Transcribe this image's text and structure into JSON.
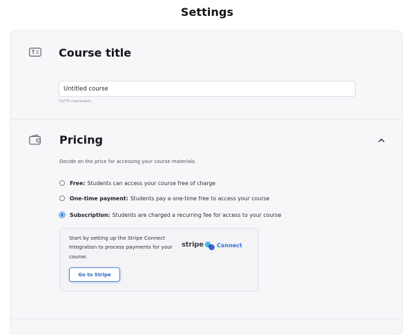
{
  "page": {
    "title": "Settings"
  },
  "course_title_section": {
    "heading": "Course title",
    "icon": "text-field-icon",
    "input_value": "Untitled course",
    "char_count": "15/70 characters"
  },
  "pricing_section": {
    "heading": "Pricing",
    "icon": "wallet-icon",
    "collapse_icon": "chevron-up-icon",
    "description": "Decide on the price for accessing your course materials.",
    "options": [
      {
        "title": "Free:",
        "text": "Students can access your course free of charge",
        "selected": false
      },
      {
        "title": "One-time payment:",
        "text": "Students pay a one-time free to access your course",
        "selected": false
      },
      {
        "title": "Subscription:",
        "text": "Students are charged a recurring fee for access to your course",
        "selected": true
      }
    ],
    "stripe_panel": {
      "text": "Start by setting up the Stripe Connect Integration to process payments for your course.",
      "logo_text": "stripe",
      "connect_label": "Connect",
      "button_label": "Go to Stripe"
    }
  },
  "colors": {
    "accent": "#2f7fe6",
    "link_blue": "#3370d8",
    "card_background": "#f7f7f9",
    "title_text": "#14161b"
  }
}
